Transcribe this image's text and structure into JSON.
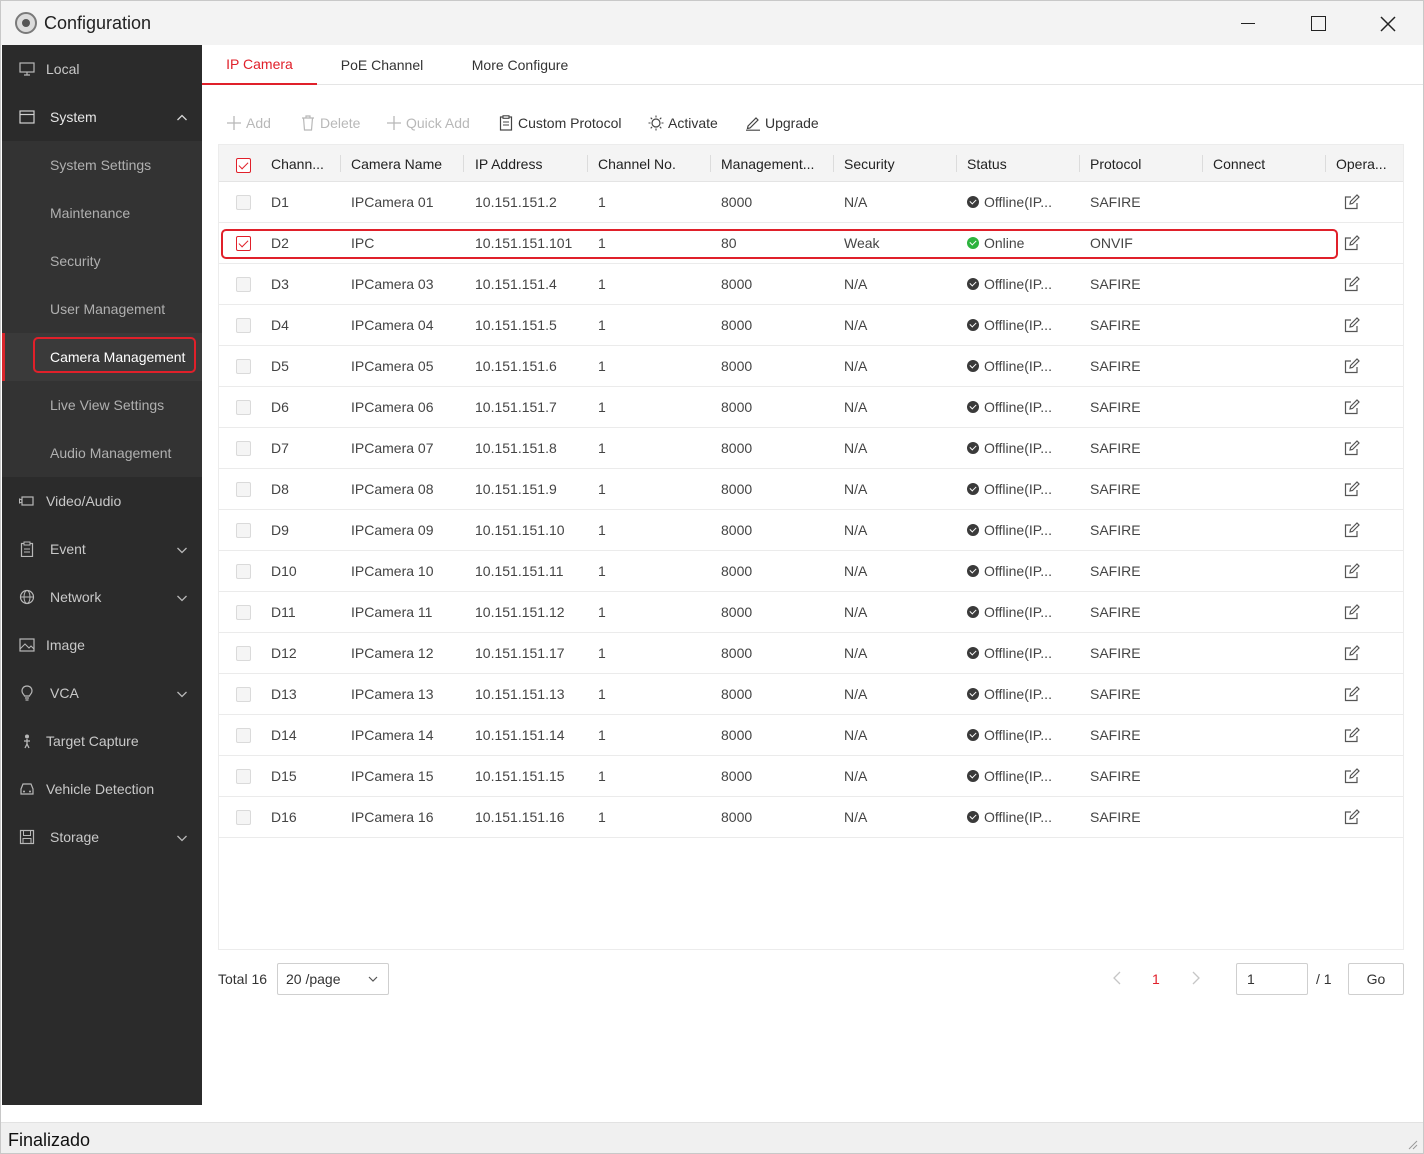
{
  "window": {
    "title": "Configuration"
  },
  "sidebar": {
    "items": [
      {
        "label": "Local",
        "icon": "monitor-icon"
      },
      {
        "label": "System",
        "icon": "system-icon",
        "expanded": true
      },
      {
        "label": "System Settings",
        "sub": true
      },
      {
        "label": "Maintenance",
        "sub": true
      },
      {
        "label": "Security",
        "sub": true
      },
      {
        "label": "User Management",
        "sub": true
      },
      {
        "label": "Camera Management",
        "sub": true,
        "active": true
      },
      {
        "label": "Live View Settings",
        "sub": true
      },
      {
        "label": "Audio Management",
        "sub": true
      },
      {
        "label": "Video/Audio",
        "icon": "video-icon"
      },
      {
        "label": "Event",
        "icon": "clipboard-icon",
        "expandable": true
      },
      {
        "label": "Network",
        "icon": "globe-icon",
        "expandable": true
      },
      {
        "label": "Image",
        "icon": "image-icon"
      },
      {
        "label": "VCA",
        "icon": "bulb-icon",
        "expandable": true
      },
      {
        "label": "Target Capture",
        "icon": "person-icon"
      },
      {
        "label": "Vehicle Detection",
        "icon": "car-icon"
      },
      {
        "label": "Storage",
        "icon": "disk-icon",
        "expandable": true
      }
    ]
  },
  "tabs": [
    {
      "label": "IP Camera",
      "active": true
    },
    {
      "label": "PoE Channel"
    },
    {
      "label": "More Configure"
    }
  ],
  "toolbar": {
    "add": "Add",
    "delete": "Delete",
    "quick_add": "Quick Add",
    "custom_protocol": "Custom Protocol",
    "activate": "Activate",
    "upgrade": "Upgrade"
  },
  "table": {
    "columns": [
      "Chann...",
      "Camera Name",
      "IP Address",
      "Channel No.",
      "Management...",
      "Security",
      "Status",
      "Protocol",
      "Connect",
      "Opera..."
    ],
    "rows": [
      {
        "channel": "D1",
        "name": "IPCamera 01",
        "ip": "10.151.151.2",
        "chno": "1",
        "port": "8000",
        "security": "N/A",
        "status": "Offline(IP...",
        "online": false,
        "protocol": "SAFIRE",
        "connect": "",
        "checked": false
      },
      {
        "channel": "D2",
        "name": "IPC",
        "ip": "10.151.151.101",
        "chno": "1",
        "port": "80",
        "security": "Weak",
        "status": "Online",
        "online": true,
        "protocol": "ONVIF",
        "connect": "",
        "checked": true
      },
      {
        "channel": "D3",
        "name": "IPCamera 03",
        "ip": "10.151.151.4",
        "chno": "1",
        "port": "8000",
        "security": "N/A",
        "status": "Offline(IP...",
        "online": false,
        "protocol": "SAFIRE",
        "connect": "",
        "checked": false
      },
      {
        "channel": "D4",
        "name": "IPCamera 04",
        "ip": "10.151.151.5",
        "chno": "1",
        "port": "8000",
        "security": "N/A",
        "status": "Offline(IP...",
        "online": false,
        "protocol": "SAFIRE",
        "connect": "",
        "checked": false
      },
      {
        "channel": "D5",
        "name": "IPCamera 05",
        "ip": "10.151.151.6",
        "chno": "1",
        "port": "8000",
        "security": "N/A",
        "status": "Offline(IP...",
        "online": false,
        "protocol": "SAFIRE",
        "connect": "",
        "checked": false
      },
      {
        "channel": "D6",
        "name": "IPCamera 06",
        "ip": "10.151.151.7",
        "chno": "1",
        "port": "8000",
        "security": "N/A",
        "status": "Offline(IP...",
        "online": false,
        "protocol": "SAFIRE",
        "connect": "",
        "checked": false
      },
      {
        "channel": "D7",
        "name": "IPCamera 07",
        "ip": "10.151.151.8",
        "chno": "1",
        "port": "8000",
        "security": "N/A",
        "status": "Offline(IP...",
        "online": false,
        "protocol": "SAFIRE",
        "connect": "",
        "checked": false
      },
      {
        "channel": "D8",
        "name": "IPCamera 08",
        "ip": "10.151.151.9",
        "chno": "1",
        "port": "8000",
        "security": "N/A",
        "status": "Offline(IP...",
        "online": false,
        "protocol": "SAFIRE",
        "connect": "",
        "checked": false
      },
      {
        "channel": "D9",
        "name": "IPCamera 09",
        "ip": "10.151.151.10",
        "chno": "1",
        "port": "8000",
        "security": "N/A",
        "status": "Offline(IP...",
        "online": false,
        "protocol": "SAFIRE",
        "connect": "",
        "checked": false
      },
      {
        "channel": "D10",
        "name": "IPCamera 10",
        "ip": "10.151.151.11",
        "chno": "1",
        "port": "8000",
        "security": "N/A",
        "status": "Offline(IP...",
        "online": false,
        "protocol": "SAFIRE",
        "connect": "",
        "checked": false
      },
      {
        "channel": "D11",
        "name": "IPCamera 11",
        "ip": "10.151.151.12",
        "chno": "1",
        "port": "8000",
        "security": "N/A",
        "status": "Offline(IP...",
        "online": false,
        "protocol": "SAFIRE",
        "connect": "",
        "checked": false
      },
      {
        "channel": "D12",
        "name": "IPCamera 12",
        "ip": "10.151.151.17",
        "chno": "1",
        "port": "8000",
        "security": "N/A",
        "status": "Offline(IP...",
        "online": false,
        "protocol": "SAFIRE",
        "connect": "",
        "checked": false
      },
      {
        "channel": "D13",
        "name": "IPCamera 13",
        "ip": "10.151.151.13",
        "chno": "1",
        "port": "8000",
        "security": "N/A",
        "status": "Offline(IP...",
        "online": false,
        "protocol": "SAFIRE",
        "connect": "",
        "checked": false
      },
      {
        "channel": "D14",
        "name": "IPCamera 14",
        "ip": "10.151.151.14",
        "chno": "1",
        "port": "8000",
        "security": "N/A",
        "status": "Offline(IP...",
        "online": false,
        "protocol": "SAFIRE",
        "connect": "",
        "checked": false
      },
      {
        "channel": "D15",
        "name": "IPCamera 15",
        "ip": "10.151.151.15",
        "chno": "1",
        "port": "8000",
        "security": "N/A",
        "status": "Offline(IP...",
        "online": false,
        "protocol": "SAFIRE",
        "connect": "",
        "checked": false
      },
      {
        "channel": "D16",
        "name": "IPCamera 16",
        "ip": "10.151.151.16",
        "chno": "1",
        "port": "8000",
        "security": "N/A",
        "status": "Offline(IP...",
        "online": false,
        "protocol": "SAFIRE",
        "connect": "",
        "checked": false
      }
    ]
  },
  "pagination": {
    "total": "Total 16",
    "page_size": "20 /page",
    "current_page": "1",
    "input_value": "1",
    "of_pages": "/ 1",
    "go": "Go"
  },
  "statusbar": {
    "text": "Finalizado"
  },
  "colors": {
    "accent": "#e0202a",
    "sidebar": "#2b2b2b",
    "online": "#2db33e",
    "offline": "#3a3a3a"
  }
}
